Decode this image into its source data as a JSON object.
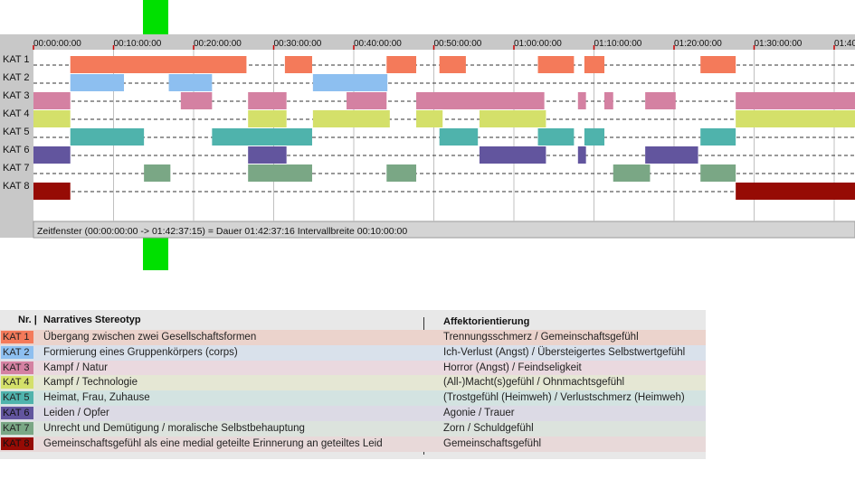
{
  "chart_data": {
    "type": "timeline",
    "x_unit": "minutes",
    "x_range": [
      0,
      102.6
    ],
    "tick_labels": [
      "00:00:00:00",
      "00:10:00:00",
      "00:20:00:00",
      "00:30:00:00",
      "00:40:00:00",
      "00:50:00:00",
      "01:00:00:00",
      "01:10:00:00",
      "01:20:00:00",
      "01:30:00:00",
      "01:40"
    ],
    "tick_values": [
      0,
      10,
      20,
      30,
      40,
      50,
      60,
      70,
      80,
      90,
      100
    ],
    "footer": "Zeitfenster (00:00:00:00 -> 01:42:37:15) = Dauer 01:42:37:16    Intervallbreite 00:10:00:00",
    "categories": [
      {
        "label": "KAT 1",
        "color": "#f47a5a",
        "segments": [
          [
            4.6,
            26.6
          ],
          [
            31.4,
            34.8
          ],
          [
            44.1,
            47.8
          ],
          [
            50.7,
            54.0
          ],
          [
            63.0,
            67.5
          ],
          [
            68.8,
            71.3
          ],
          [
            83.3,
            87.7
          ]
        ]
      },
      {
        "label": "KAT 2",
        "color": "#8dbff0",
        "segments": [
          [
            4.6,
            11.3
          ],
          [
            16.9,
            22.3
          ],
          [
            34.9,
            44.2
          ]
        ]
      },
      {
        "label": "KAT 3",
        "color": "#d481a2",
        "segments": [
          [
            0.0,
            4.6
          ],
          [
            18.4,
            22.3
          ],
          [
            26.8,
            31.6
          ],
          [
            39.1,
            44.1
          ],
          [
            47.8,
            63.8
          ],
          [
            68.0,
            69.0
          ],
          [
            71.3,
            72.4
          ],
          [
            76.4,
            80.2
          ],
          [
            87.7,
            102.6
          ]
        ]
      },
      {
        "label": "KAT 4",
        "color": "#d4e06a",
        "segments": [
          [
            0.0,
            4.6
          ],
          [
            26.8,
            31.6
          ],
          [
            34.9,
            44.5
          ],
          [
            47.8,
            51.1
          ],
          [
            55.7,
            64.0
          ],
          [
            87.7,
            102.6
          ]
        ]
      },
      {
        "label": "KAT 5",
        "color": "#4fb3ac",
        "segments": [
          [
            4.6,
            13.8
          ],
          [
            22.3,
            34.8
          ],
          [
            50.7,
            55.5
          ],
          [
            63.0,
            67.5
          ],
          [
            68.8,
            71.3
          ],
          [
            83.3,
            87.7
          ]
        ]
      },
      {
        "label": "KAT 6",
        "color": "#62559e",
        "segments": [
          [
            0.0,
            4.6
          ],
          [
            26.8,
            31.6
          ],
          [
            55.7,
            64.0
          ],
          [
            68.0,
            69.0
          ],
          [
            76.4,
            83.0
          ]
        ]
      },
      {
        "label": "KAT 7",
        "color": "#7aa785",
        "segments": [
          [
            13.8,
            17.1
          ],
          [
            26.8,
            34.8
          ],
          [
            44.1,
            47.8
          ],
          [
            72.4,
            77.0
          ],
          [
            83.3,
            87.7
          ]
        ]
      },
      {
        "label": "KAT 8",
        "color": "#960b05",
        "segments": [
          [
            0.0,
            4.6
          ],
          [
            87.7,
            102.6
          ]
        ]
      }
    ]
  },
  "legend": {
    "header": {
      "nr": "Nr. |",
      "stereotype": "Narratives Stereotyp",
      "affekt": "Affektorientierung"
    },
    "rows": [
      {
        "cat": "KAT 1",
        "color": "#f47a5a",
        "bg": "#ebd3cc",
        "stereotype": "Übergang zwischen zwei Gesellschaftsformen",
        "affekt": "Trennungsschmerz / Gemeinschaftsgefühl"
      },
      {
        "cat": "KAT 2",
        "color": "#8dbff0",
        "bg": "#d9e1eb",
        "stereotype": "Formierung eines Gruppenkörpers (corps)",
        "affekt": "Ich-Verlust (Angst) / Übersteigertes Selbstwertgefühl"
      },
      {
        "cat": "KAT 3",
        "color": "#d481a2",
        "bg": "#ead9df",
        "stereotype": "Kampf / Natur",
        "affekt": "Horror (Angst) / Feindseligkeit"
      },
      {
        "cat": "KAT 4",
        "color": "#d4e06a",
        "bg": "#e5e7d4",
        "stereotype": "Kampf / Technologie",
        "affekt": "(All-)Macht(s)gefühl / Ohnmachtsgefühl"
      },
      {
        "cat": "KAT 5",
        "color": "#4fb3ac",
        "bg": "#d3e3e1",
        "stereotype": "Heimat, Frau, Zuhause",
        "affekt": "(Trostgefühl (Heimweh) / Verlustschmerz (Heimweh)"
      },
      {
        "cat": "KAT 6",
        "color": "#62559e",
        "bg": "#dcdae5",
        "stereotype": "Leiden / Opfer",
        "affekt": "Agonie / Trauer"
      },
      {
        "cat": "KAT 7",
        "color": "#7aa785",
        "bg": "#dce3dd",
        "stereotype": "Unrecht und Demütigung / moralische Selbstbehauptung",
        "affekt": "Zorn / Schuldgefühl"
      },
      {
        "cat": "KAT 8",
        "color": "#960b05",
        "bg": "#e8d9d9",
        "stereotype": "Gemeinschaftsgefühl als eine medial geteilte Erinnerung an geteiltes Leid",
        "affekt": "Gemeinschaftsgefühl"
      }
    ]
  }
}
